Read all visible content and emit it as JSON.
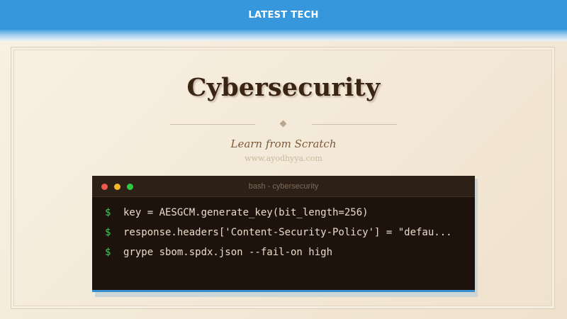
{
  "header": {
    "label": "LATEST TECH",
    "color": "#3697dc"
  },
  "title": "Cybersecurity",
  "subtitle": "Learn from Scratch",
  "website": "www.ayodhyya.com",
  "terminal": {
    "title": "bash - cybersecurity",
    "prompt": "$",
    "commands": [
      "key = AESGCM.generate_key(bit_length=256)",
      "response.headers['Content-Security-Policy'] = \"defau...",
      "grype sbom.spdx.json --fail-on high"
    ],
    "window_controls": [
      "close",
      "minimize",
      "maximize"
    ]
  }
}
